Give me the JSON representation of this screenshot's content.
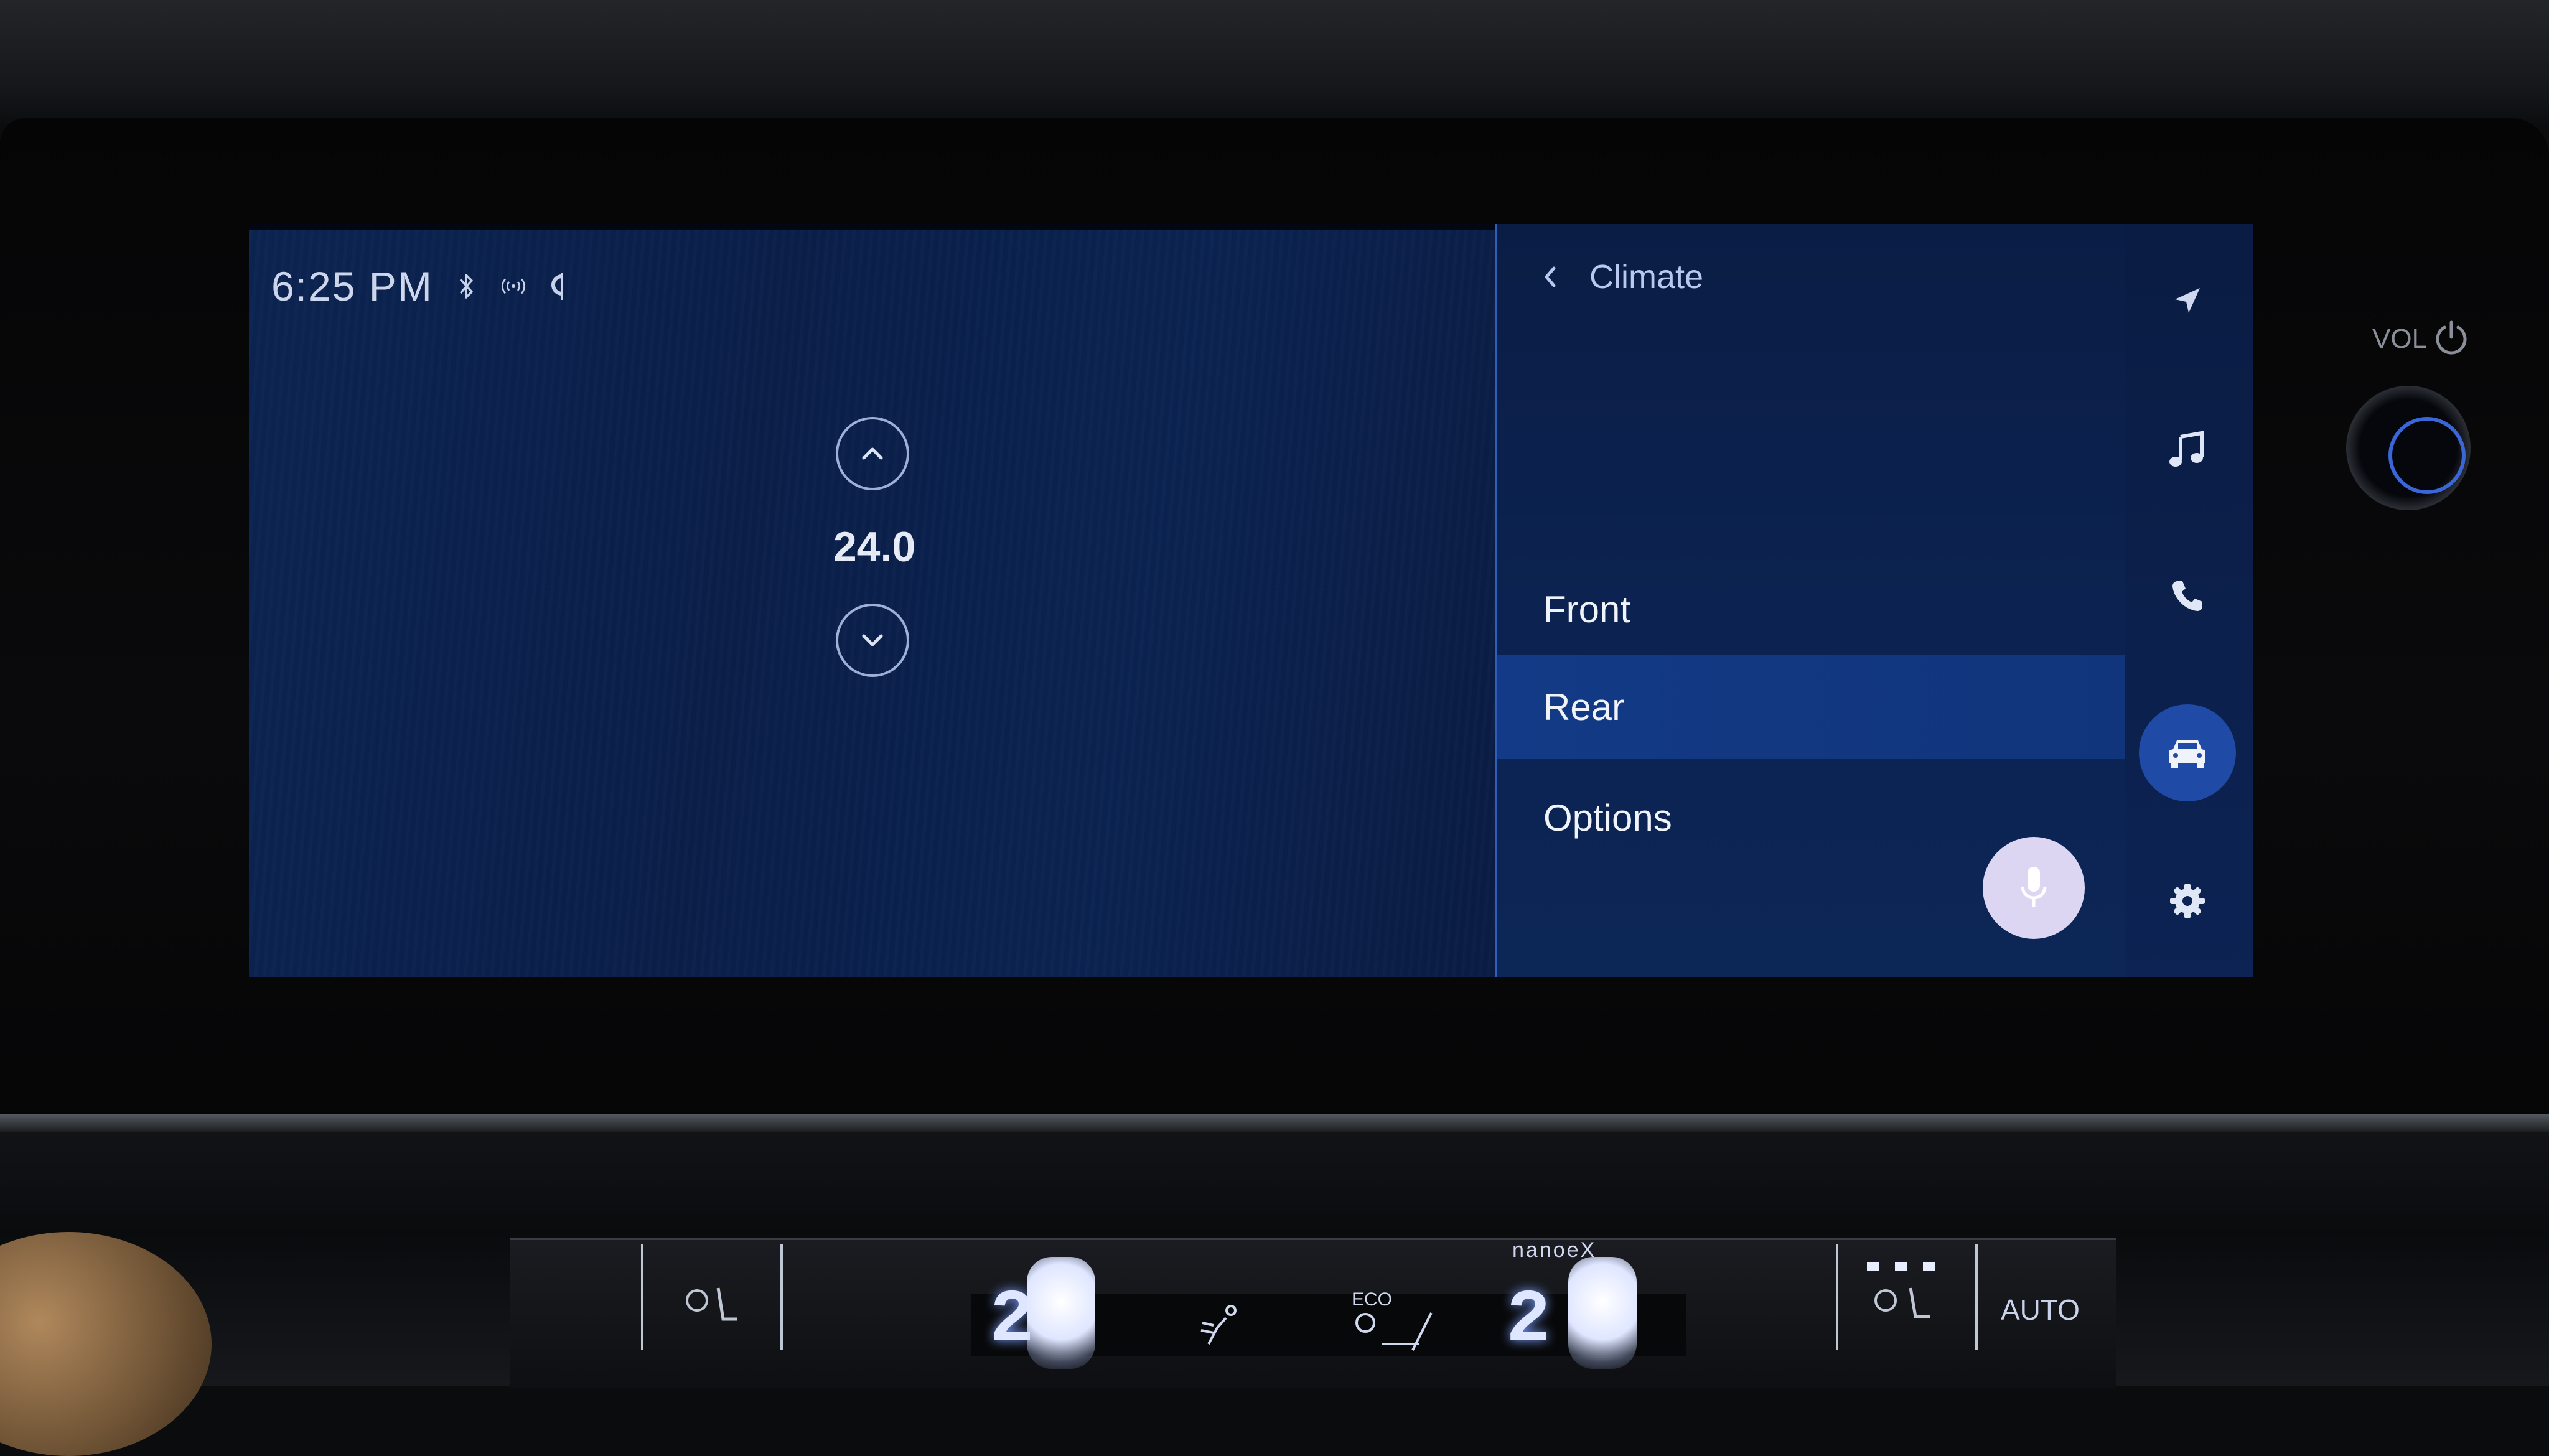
{
  "status_bar": {
    "time": "6:25 PM",
    "icons": [
      "bluetooth-icon",
      "wireless-signal-icon",
      "wireless-charging-icon"
    ]
  },
  "temperature": {
    "value": "24.0",
    "up_icon": "chevron-up-icon",
    "down_icon": "chevron-down-icon"
  },
  "menu": {
    "title": "Climate",
    "back_icon": "chevron-left-icon",
    "items": [
      {
        "label": "Front",
        "selected": false
      },
      {
        "label": "Rear",
        "selected": true
      },
      {
        "label": "Options",
        "selected": false
      }
    ],
    "mic_icon": "microphone-icon"
  },
  "rail": {
    "items": [
      "navigation-icon",
      "music-icon",
      "phone-icon",
      "car-icon",
      "gear-icon"
    ],
    "active": "car-icon"
  },
  "hardware": {
    "vol_label": "VOL",
    "eco_label": "ECO",
    "nanoe_label": "nanoeX",
    "auto_label": "AUTO"
  },
  "colors": {
    "accent": "#1f4aa6",
    "selected_row": "#123a86",
    "mic_button": "#ddd6f3",
    "divider": "#2f5eb8"
  }
}
